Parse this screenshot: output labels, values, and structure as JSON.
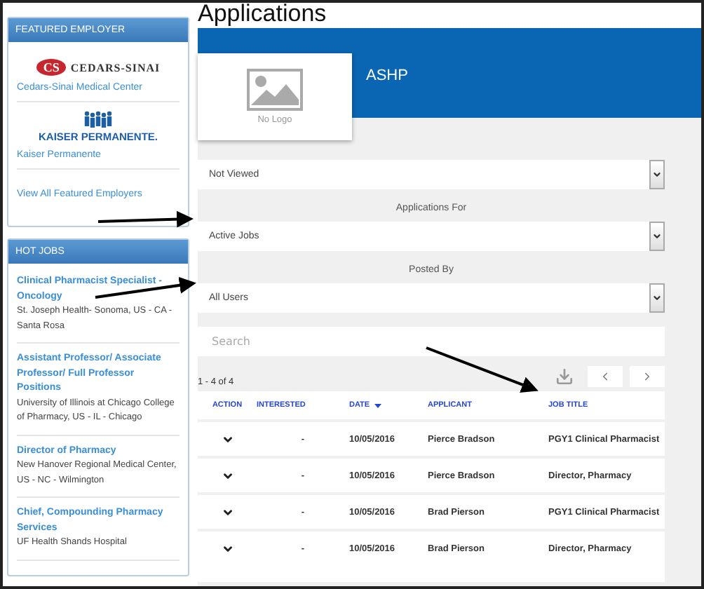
{
  "sidebar": {
    "featured": {
      "title": "FEATURED EMPLOYER",
      "employers": [
        {
          "kind": "cedars",
          "logo_monogram": "CS",
          "logo_text": "CEDARS-SINAI",
          "name": "Cedars-Sinai Medical Center"
        },
        {
          "kind": "kaiser",
          "logo_text": "KAISER PERMANENTE.",
          "name": "Kaiser Permanente"
        }
      ],
      "link": "View All Featured Employers"
    },
    "hot_jobs": {
      "title": "HOT JOBS",
      "jobs": [
        {
          "title": "Clinical Pharmacist Specialist - Oncology",
          "employer": "St. Joseph Health- Sonoma, US - CA - Santa Rosa"
        },
        {
          "title": "Assistant Professor/ Associate Professor/ Full Professor Positions",
          "employer": "University of Illinois at Chicago College of Pharmacy, US - IL - Chicago"
        },
        {
          "title": "Director of Pharmacy",
          "employer": "New Hanover Regional Medical Center, US - NC - Wilmington"
        },
        {
          "title": "Chief, Compounding Pharmacy Services",
          "employer": "UF Health Shands Hospital"
        }
      ]
    }
  },
  "page_title": "Applications",
  "employer": {
    "logo_placeholder": "No Logo",
    "name": "ASHP"
  },
  "filters": [
    {
      "value": "Not Viewed"
    },
    {
      "label": "Applications For",
      "value": "Active Jobs"
    },
    {
      "label": "Posted By",
      "value": "All Users"
    }
  ],
  "search": {
    "placeholder": "Search"
  },
  "results_count": "1 - 4 of 4",
  "table": {
    "columns": [
      {
        "label": "ACTION",
        "sorted": false
      },
      {
        "label": "INTERESTED",
        "sorted": false
      },
      {
        "label": "DATE",
        "sorted": true
      },
      {
        "label": "APPLICANT",
        "sorted": false
      },
      {
        "label": "JOB TITLE",
        "sorted": false
      }
    ],
    "rows": [
      {
        "interested": "-",
        "date": "10/05/2016",
        "applicant": "Pierce Bradson",
        "job_title": "PGY1 Clinical Pharmacist"
      },
      {
        "interested": "-",
        "date": "10/05/2016",
        "applicant": "Pierce Bradson",
        "job_title": "Director, Pharmacy"
      },
      {
        "interested": "-",
        "date": "10/05/2016",
        "applicant": "Brad Pierson",
        "job_title": "PGY1 Clinical Pharmacist"
      },
      {
        "interested": "-",
        "date": "10/05/2016",
        "applicant": "Brad Pierson",
        "job_title": "Director, Pharmacy"
      }
    ]
  }
}
